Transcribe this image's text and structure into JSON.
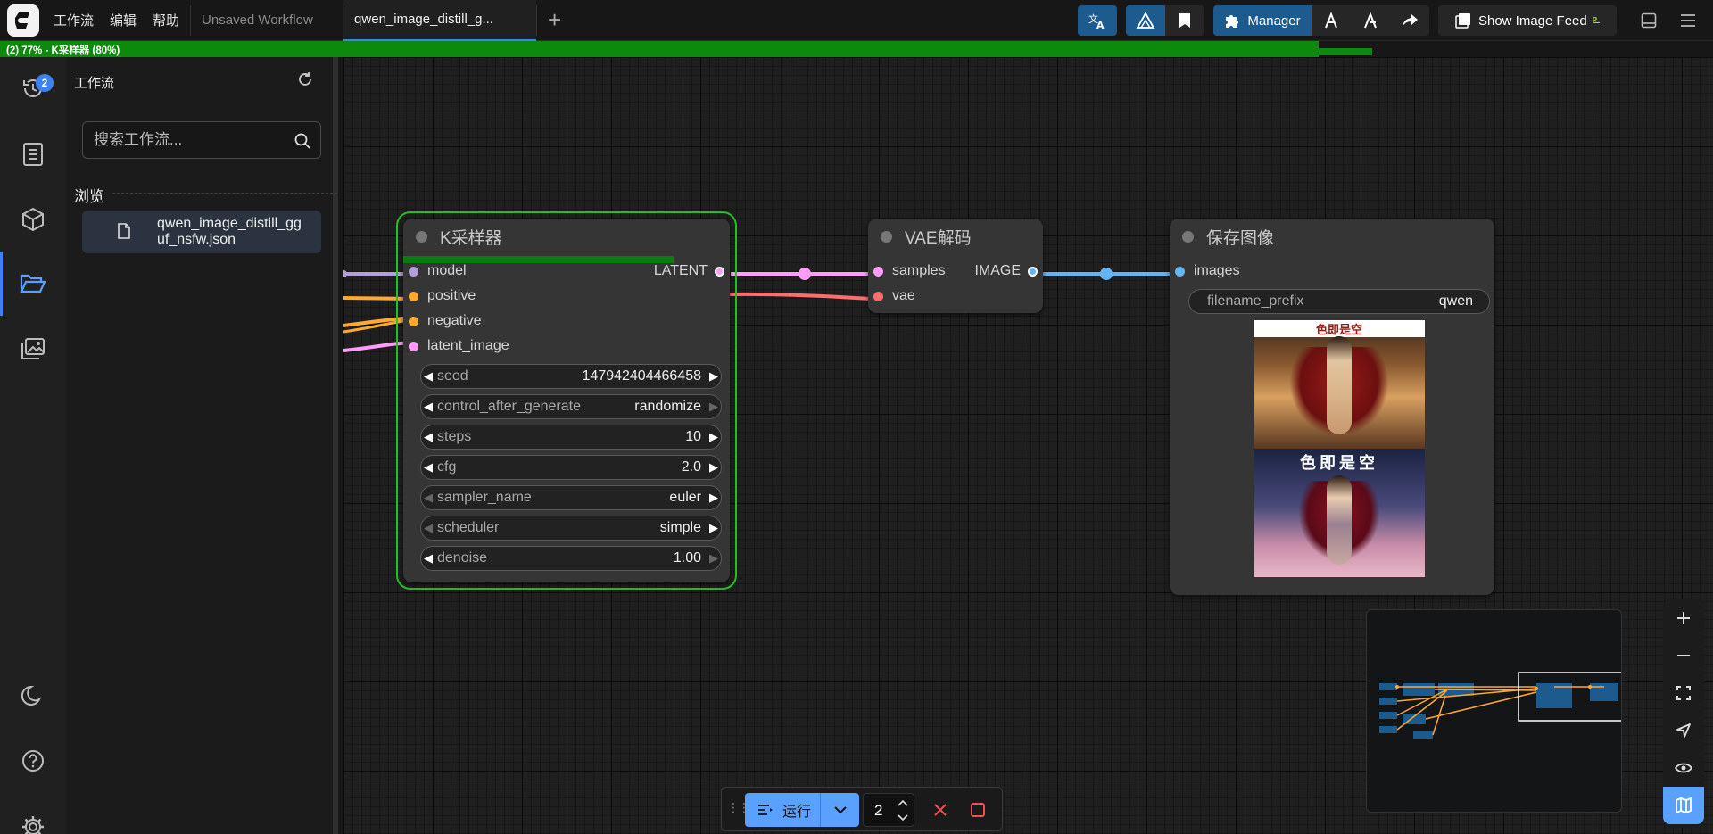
{
  "menu": {
    "workflow": "工作流",
    "edit": "编辑",
    "help": "帮助"
  },
  "tabs": [
    {
      "label": "Unsaved Workflow"
    },
    {
      "label": "qwen_image_distill_g..."
    }
  ],
  "topbar": {
    "manager_label": "Manager",
    "image_feed_label": "Show Image Feed"
  },
  "progress": {
    "text": "(2) 77% - K采样器 (80%)",
    "fraction": 0.8
  },
  "iconbar": {
    "queue_badge": "2"
  },
  "sidepanel": {
    "title": "工作流",
    "search_placeholder": "搜索工作流...",
    "browse_label": "浏览",
    "file_name": "qwen_image_distill_gguf_nsfw.json"
  },
  "nodes": {
    "ksampler": {
      "title": "K采样器",
      "inputs": [
        "model",
        "positive",
        "negative",
        "latent_image"
      ],
      "output": "LATENT",
      "widgets": [
        {
          "label": "seed",
          "value": "147942404466458"
        },
        {
          "label": "control_after_generate",
          "value": "randomize"
        },
        {
          "label": "steps",
          "value": "10"
        },
        {
          "label": "cfg",
          "value": "2.0"
        },
        {
          "label": "sampler_name",
          "value": "euler"
        },
        {
          "label": "scheduler",
          "value": "simple"
        },
        {
          "label": "denoise",
          "value": "1.00"
        }
      ],
      "progress": 0.8
    },
    "vae": {
      "title": "VAE解码",
      "inputs": [
        "samples",
        "vae"
      ],
      "output": "IMAGE"
    },
    "save": {
      "title": "保存图像",
      "input": "images",
      "prefix_label": "filename_prefix",
      "prefix_value": "qwen",
      "image_caption_1": "色即是空",
      "image_caption_2": "色即是空"
    }
  },
  "runbar": {
    "run_label": "运行",
    "count": "2"
  },
  "colors": {
    "accent": "#3b82f6",
    "progress": "#0d8a0d",
    "node_selected": "#22c022",
    "wire_model": "#b39ddb",
    "wire_cond": "#ffa931",
    "wire_latent": "#ff9cf9",
    "wire_vae": "#ff6e6e",
    "wire_image": "#64b5f6"
  }
}
